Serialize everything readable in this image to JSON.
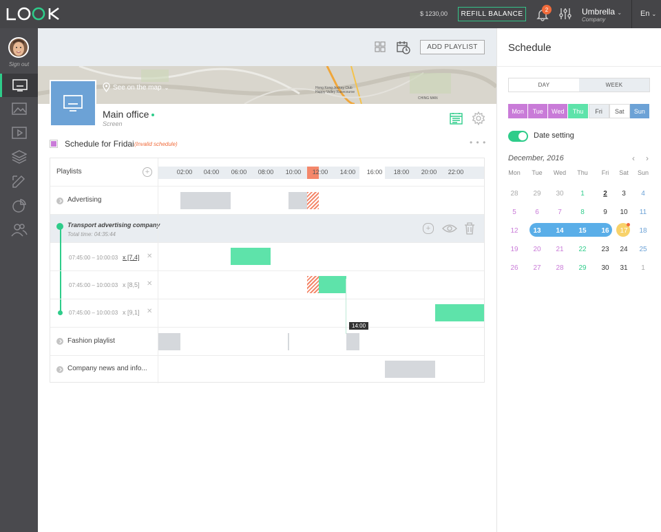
{
  "topbar": {
    "logo_text": "LOOK",
    "balance": "$ 1230,00",
    "refill_label": "REFILL BALANCE",
    "notification_count": "2",
    "company_name": "Umbrella",
    "company_role": "Company",
    "language": "En"
  },
  "sidebar": {
    "sign_out": "Sign out",
    "items": [
      "screens-icon",
      "images-icon",
      "video-icon",
      "layers-icon",
      "edit-icon",
      "analytics-icon",
      "users-icon"
    ]
  },
  "header": {
    "add_playlist_label": "ADD PLAYLIST"
  },
  "map": {
    "see_on_map": "See on the map",
    "labels": [
      "Hong Kong Jockey Club",
      "Happy Valley Racecourse",
      "CHING MAN"
    ]
  },
  "screen": {
    "title": "Main office",
    "subtitle": "Screen"
  },
  "schedule": {
    "title": "Schedule for Fridai",
    "invalid": "(Invalid schedule)",
    "more": "• • •"
  },
  "timeline": {
    "header_label": "Playlists",
    "ticks": [
      "02:00",
      "04:00",
      "06:00",
      "08:00",
      "10:00",
      "12:00",
      "14:00",
      "16:00",
      "18:00",
      "20:00",
      "22:00"
    ],
    "rows": {
      "advertising": "Advertising",
      "group_title": "Transport advertising company",
      "group_total": "Total time: 04:35:44",
      "item1_time": "07:45:00 – 10:00:03",
      "item1_mult": "x [7,4]",
      "item2_time": "07:45:00 – 10:00:03",
      "item2_mult": "x [8,5]",
      "item3_time": "07:45:00 – 10:00:03",
      "item3_mult": "x [9,1]",
      "fashion": "Fashion playlist",
      "news": "Company news and info..."
    },
    "tooltip": "14:00"
  },
  "rpanel": {
    "title": "Schedule",
    "day_label": "DAY",
    "week_label": "WEEK",
    "weekdays": [
      {
        "label": "Mon",
        "color": "#c97bd8"
      },
      {
        "label": "Tue",
        "color": "#c97bd8"
      },
      {
        "label": "Wed",
        "color": "#c97bd8"
      },
      {
        "label": "Thu",
        "color": "#5ee3aa"
      },
      {
        "label": "Fri",
        "color": "#e9edf1"
      },
      {
        "label": "Sat",
        "color": "#ffffff"
      },
      {
        "label": "Sun",
        "color": "#6ca2d6"
      }
    ],
    "date_setting": "Date setting",
    "month": "December, 2016",
    "prev": "‹",
    "next": "›",
    "wd": [
      "Mon",
      "Tue",
      "Wed",
      "Thu",
      "Fri",
      "Sat",
      "Sun"
    ],
    "weeks": [
      [
        "28",
        "29",
        "30",
        "1",
        "2",
        "3",
        "4"
      ],
      [
        "5",
        "6",
        "7",
        "8",
        "9",
        "10",
        "11"
      ],
      [
        "12",
        "13",
        "14",
        "15",
        "16",
        "17",
        "18"
      ],
      [
        "19",
        "20",
        "21",
        "22",
        "23",
        "24",
        "25"
      ],
      [
        "26",
        "27",
        "28",
        "29",
        "30",
        "31",
        "1"
      ]
    ]
  }
}
